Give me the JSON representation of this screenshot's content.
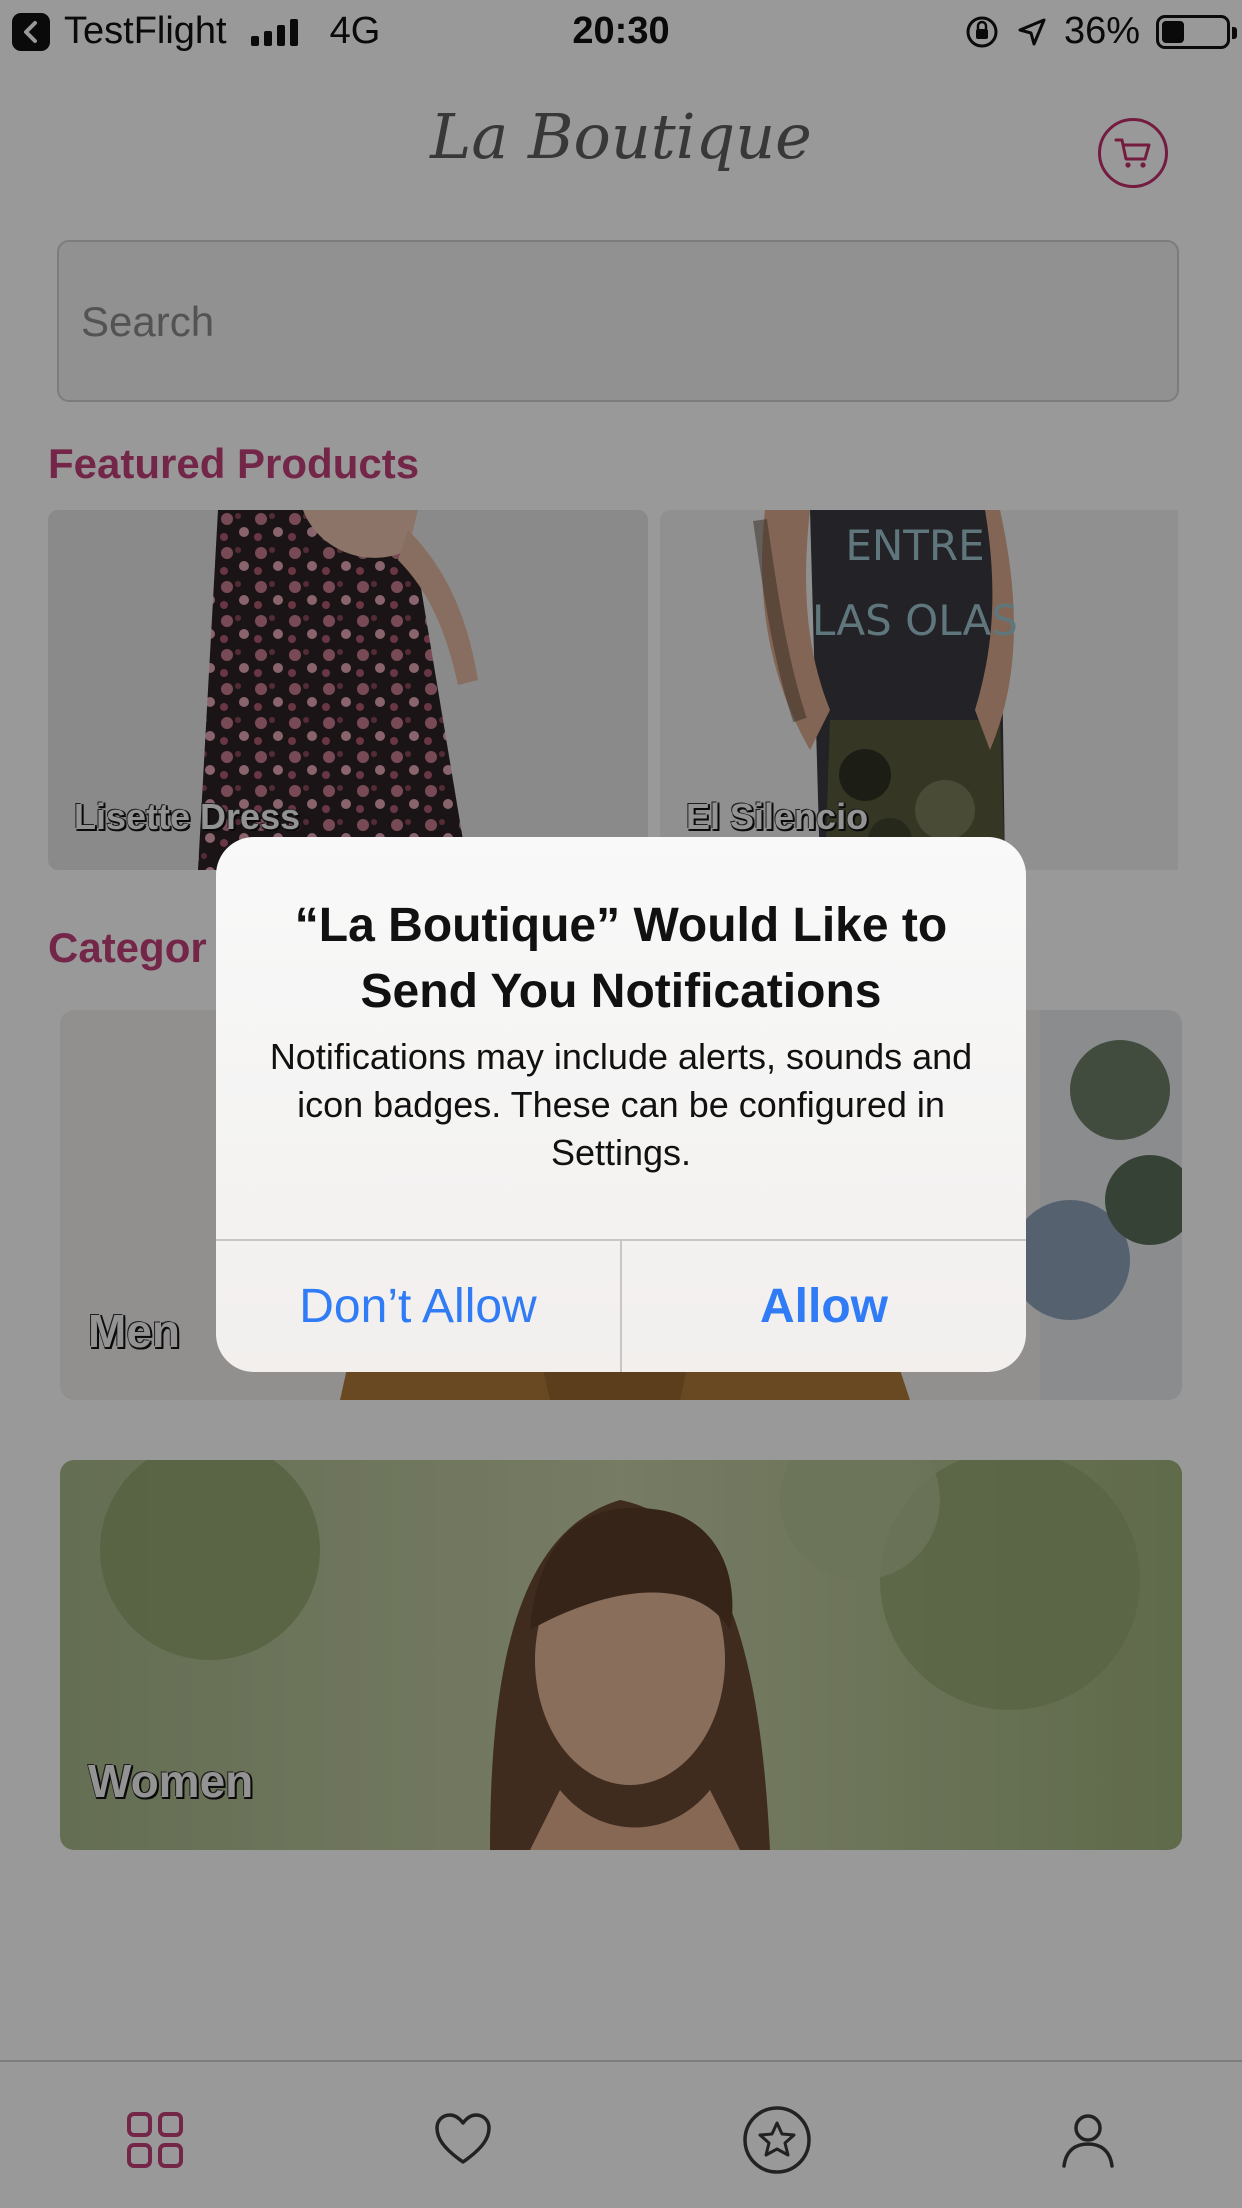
{
  "status_bar": {
    "app_back": "TestFlight",
    "network": "4G",
    "time": "20:30",
    "battery": "36%",
    "battery_level": 0.36
  },
  "header": {
    "brand": "La Boutique",
    "cart_icon": "cart-icon"
  },
  "search": {
    "placeholder": "Search"
  },
  "featured": {
    "title": "Featured Products",
    "items": [
      {
        "label": "Lisette Dress"
      },
      {
        "label": "El Silencio"
      }
    ]
  },
  "categories": {
    "title": "Categor",
    "items": [
      {
        "label": "Men"
      },
      {
        "label": "Women"
      }
    ]
  },
  "tabbar": {
    "items": [
      {
        "icon": "grid-icon",
        "active": true
      },
      {
        "icon": "heart-icon",
        "active": false
      },
      {
        "icon": "star-circle-icon",
        "active": false
      },
      {
        "icon": "user-icon",
        "active": false
      }
    ]
  },
  "alert": {
    "title": "“La Boutique” Would Like to Send You Notifications",
    "message": "Notifications may include alerts, sounds and icon badges. These can be configured in Settings.",
    "deny_label": "Don’t Allow",
    "allow_label": "Allow"
  },
  "colors": {
    "accent": "#c2407a",
    "ios_blue": "#2f7cf6",
    "overlay": "rgba(0,0,0,0.40)"
  }
}
